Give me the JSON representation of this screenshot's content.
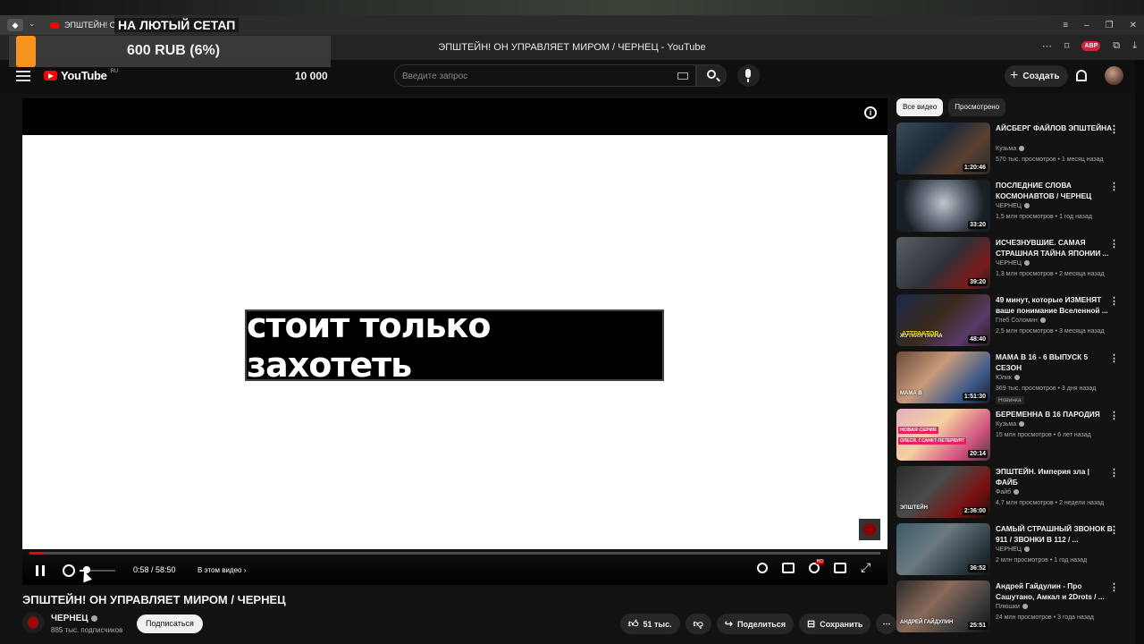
{
  "stream_overlay": {
    "title": "НА ЛЮТЫЙ СЕТАП",
    "donation_amount": "600 RUB (6%)",
    "accent_color": "#f7941d"
  },
  "browser": {
    "tab_title": "ЭПШТЕЙН! ОН",
    "page_title": "ЭПШТЕЙН! ОН УПРАВЛЯЕТ МИРОМ / ЧЕРНЕЦ - YouTube",
    "adblock_label": "ABP"
  },
  "header": {
    "logo_text": "YouTube",
    "region": "RU",
    "counter": "10 000",
    "search_placeholder": "Введите запрос",
    "create_label": "Создать"
  },
  "player": {
    "caption": "стоит только захотеть",
    "time": "0:58 / 58:50",
    "chapters_label": "В этом видео",
    "progress_fraction": 0.0164,
    "volume_fraction": 0.2
  },
  "video": {
    "title": "ЭПШТЕЙН! ОН УПРАВЛЯЕТ МИРОМ / ЧЕРНЕЦ",
    "channel": "ЧЕРНЕЦ",
    "subscribers": "885 тыс. подписчиков",
    "subscribe_label": "Подписаться",
    "likes": "51 тыс.",
    "share_label": "Поделиться",
    "save_label": "Сохранить"
  },
  "sidebar": {
    "chips": [
      "Все видео",
      "Просмотрено"
    ],
    "items": [
      {
        "title": "АЙСБЕРГ ФАЙЛОВ ЭПШТЕЙНА",
        "channel": "Кузьма",
        "meta": "570 тыс. просмотров • 1 месяц назад",
        "duration": "1:20:46",
        "badge": ""
      },
      {
        "title": "ПОСЛЕДНИЕ СЛОВА КОСМОНАВТОВ / ЧЕРНЕЦ",
        "channel": "ЧЕРНЕЦ",
        "meta": "1,5 млн просмотров • 1 год назад",
        "duration": "33:20",
        "badge": ""
      },
      {
        "title": "ИСЧЕЗНУВШИЕ. САМАЯ СТРАШНАЯ ТАЙНА ЯПОНИИ ...",
        "channel": "ЧЕРНЕЦ",
        "meta": "1,3 млн просмотров • 2 месяца назад",
        "duration": "39:20",
        "badge": ""
      },
      {
        "title": "49 минут, которые ИЗМЕНЯТ ваше понимание Вселенной ...",
        "channel": "Глеб Соломин",
        "meta": "2,5 млн просмотров • 3 месяца назад",
        "duration": "48:40",
        "badge": "",
        "overlay": "ЖУТКАЯ ТАЙНА",
        "overlay2": "АТТРАКТОР"
      },
      {
        "title": "МАМА В 16 - 6 ВЫПУСК 5 СЕЗОН",
        "channel": "Юлик",
        "meta": "369 тыс. просмотров • 3 дня назад",
        "duration": "1:51:30",
        "badge": "Новинка",
        "overlay": "МАМА В"
      },
      {
        "title": "БЕРЕМЕННА В 16 ПАРОДИЯ",
        "channel": "Кузьма",
        "meta": "15 млн просмотров • 6 лет назад",
        "duration": "20:14",
        "badge": "",
        "overlay": "НОВАЯ СЕРИЯ",
        "overlay2": "ОЛЕСЯ, Г.САНКТ-ПЕТЕРБУРГ"
      },
      {
        "title": "ЭПШТЕЙН. Империя зла | ФАЙБ",
        "channel": "Файб",
        "meta": "4,7 млн просмотров • 2 недели назад",
        "duration": "2:36:00",
        "badge": "",
        "overlay": "ЭПШТЕЙН"
      },
      {
        "title": "САМЫЙ СТРАШНЫЙ ЗВОНОК В 911 / ЗВОНКИ В 112 / ...",
        "channel": "ЧЕРНЕЦ",
        "meta": "2 млн просмотров • 1 год назад",
        "duration": "36:52",
        "badge": ""
      },
      {
        "title": "Андрей Гайдулин - Про Сашутано, Амкал и 2Drots / ...",
        "channel": "Плюшки",
        "meta": "24 млн просмотров • 3 года назад",
        "duration": "25:51",
        "badge": "",
        "overlay": "АНДРЕЙ ГАЙДУЛИН"
      }
    ]
  }
}
